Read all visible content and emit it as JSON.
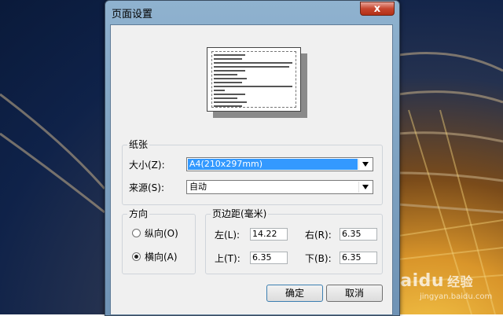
{
  "window": {
    "title": "页面设置",
    "close_glyph": "x"
  },
  "paper_group": {
    "title": "纸张",
    "size_label": "大小(Z):",
    "size_value": "A4(210x297mm)",
    "source_label": "来源(S):",
    "source_value": "自动"
  },
  "orientation_group": {
    "title": "方向",
    "portrait_label": "纵向(O)",
    "landscape_label": "横向(A)",
    "selected": "landscape"
  },
  "margins_group": {
    "title": "页边距(毫米)",
    "left_label": "左(L):",
    "left_value": "14.22",
    "right_label": "右(R):",
    "right_value": "6.35",
    "top_label": "上(T):",
    "top_value": "6.35",
    "bottom_label": "下(B):",
    "bottom_value": "6.35"
  },
  "buttons": {
    "ok": "确定",
    "cancel": "取消"
  },
  "watermark": {
    "brand": "Baidu",
    "brand_sub": "经验",
    "url": "jingyan.baidu.com"
  }
}
